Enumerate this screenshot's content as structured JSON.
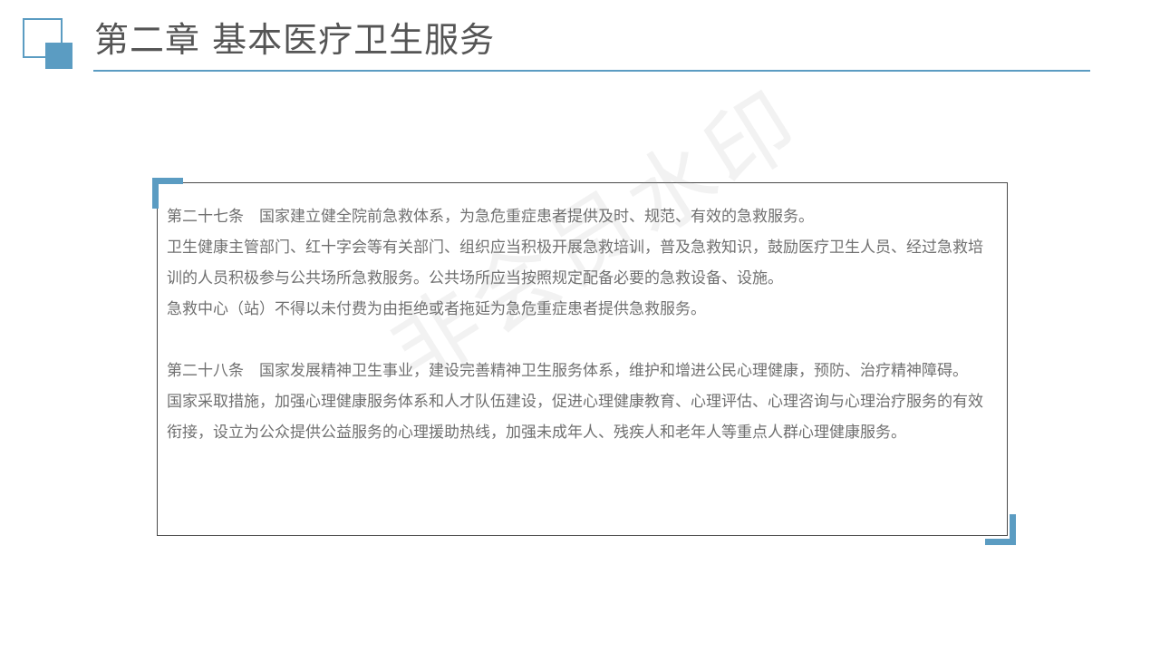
{
  "header": {
    "title": "第二章 基本医疗卫生服务"
  },
  "watermark": {
    "text": "非会员水印"
  },
  "article27": {
    "line1": "第二十七条　国家建立健全院前急救体系，为急危重症患者提供及时、规范、有效的急救服务。",
    "line2": "卫生健康主管部门、红十字会等有关部门、组织应当积极开展急救培训，普及急救知识，鼓励医疗卫生人员、经过急救培训的人员积极参与公共场所急救服务。公共场所应当按照规定配备必要的急救设备、设施。",
    "line3": "急救中心（站）不得以未付费为由拒绝或者拖延为急危重症患者提供急救服务。"
  },
  "article28": {
    "line1": "第二十八条　国家发展精神卫生事业，建设完善精神卫生服务体系，维护和增进公民心理健康，预防、治疗精神障碍。",
    "line2": "国家采取措施，加强心理健康服务体系和人才队伍建设，促进心理健康教育、心理评估、心理咨询与心理治疗服务的有效衔接，设立为公众提供公益服务的心理援助热线，加强未成年人、残疾人和老年人等重点人群心理健康服务。"
  },
  "colors": {
    "accent": "#5b9cc2",
    "title_text": "#555555",
    "body_text": "#707070",
    "frame_border": "#4a4a4a"
  }
}
